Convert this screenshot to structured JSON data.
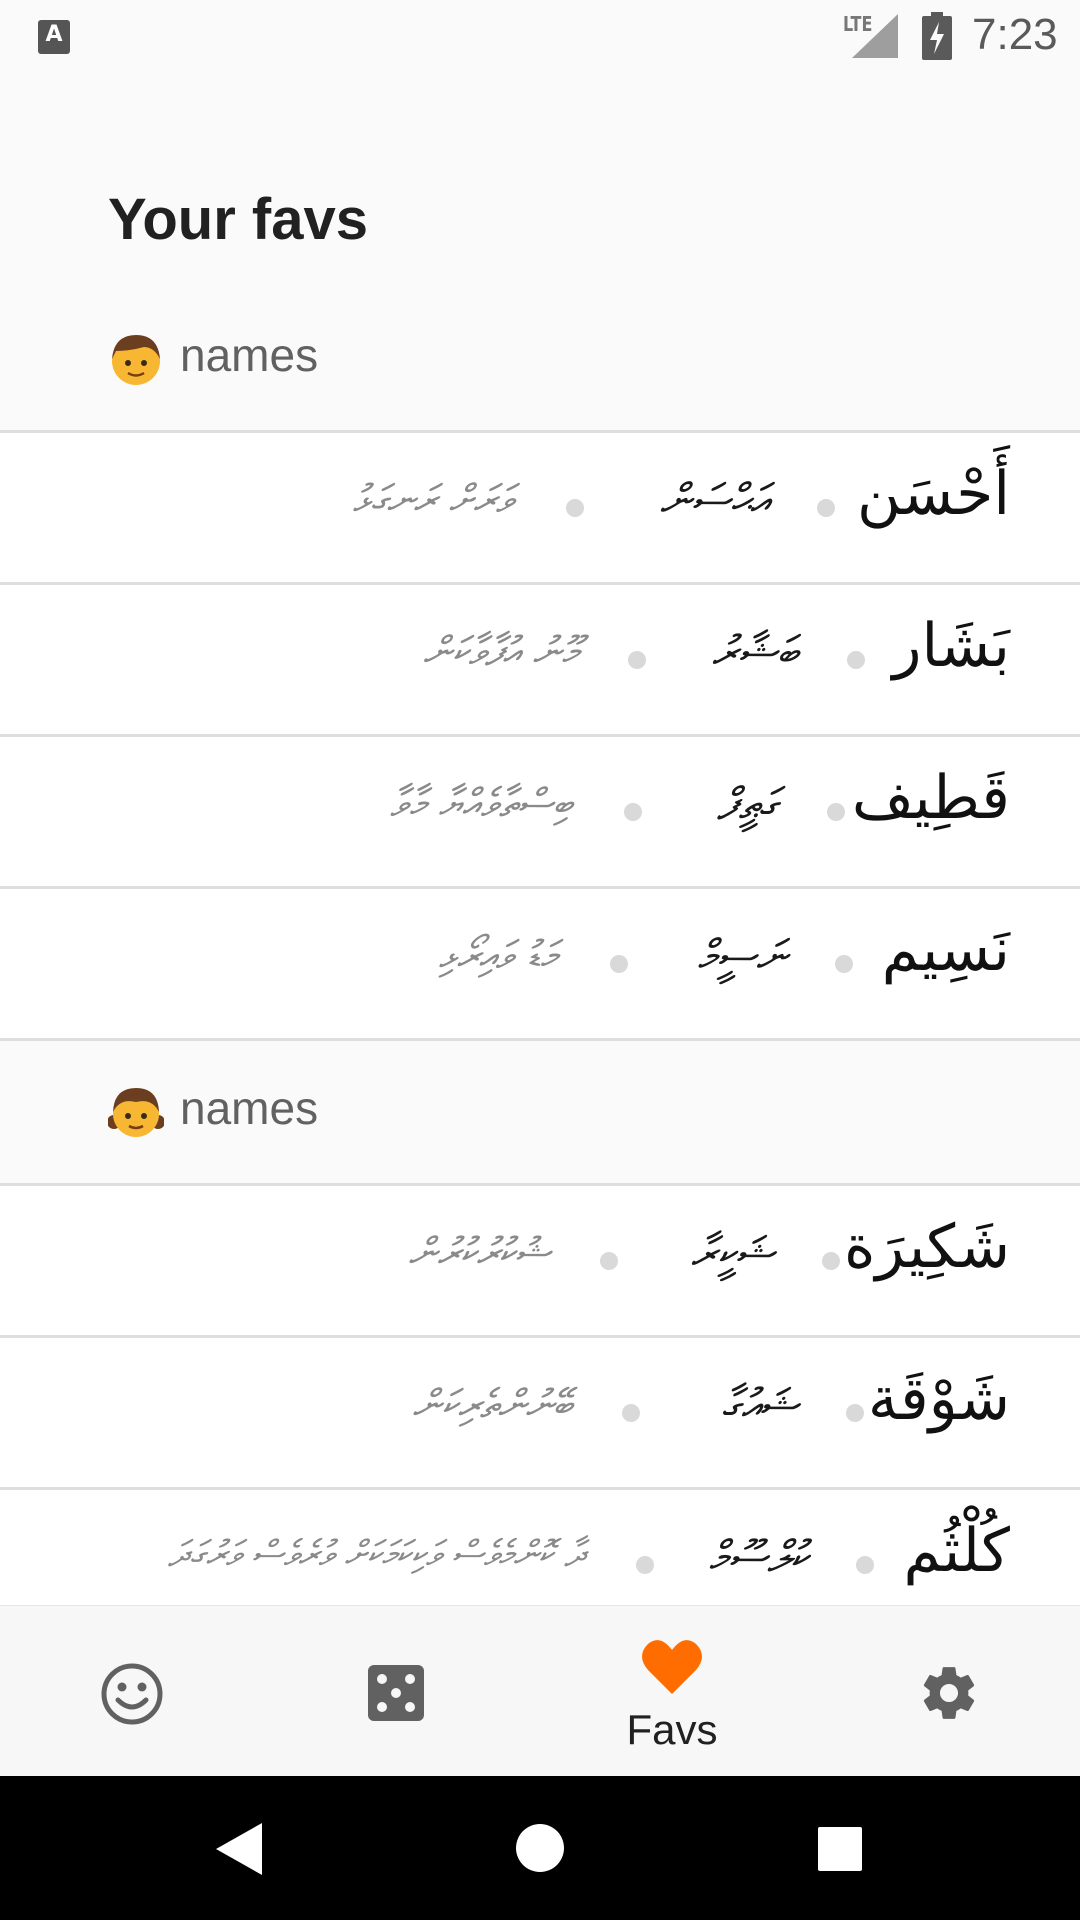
{
  "status_bar": {
    "app_icon_letter": "A",
    "network": "LTE",
    "time": "7:23"
  },
  "page": {
    "title": "Your favs"
  },
  "sections": [
    {
      "emoji": "boy-emoji",
      "label": "names",
      "names": [
        {
          "arabic": "أَحْسَن",
          "thaana": "އަޙްސަން",
          "meaning": "ވަރަށް ރަނގަޅު"
        },
        {
          "arabic": "بَشَار",
          "thaana": "ބަޝާރު",
          "meaning": "މޫނު އުފާވާކަން"
        },
        {
          "arabic": "قَطِيف",
          "thaana": "ގަޠީފް",
          "meaning": "ބިސްތާވެއްޔާ މާވާ"
        },
        {
          "arabic": "نَسِيم",
          "thaana": "ނަސީމް",
          "meaning": "މަޑު ވައިރޯޅި"
        }
      ]
    },
    {
      "emoji": "girl-emoji",
      "label": "names",
      "names": [
        {
          "arabic": "شَكِيرَة",
          "thaana": "ޝަކީރާ",
          "meaning": "ޝުކުރުކުރުން"
        },
        {
          "arabic": "شَوْقَة",
          "thaana": "ޝައުގާ",
          "meaning": "ބޭނުންތެރިކަން"
        },
        {
          "arabic": "كُلْثُم",
          "thaana": "ކުލްސޫމް",
          "meaning": "ދާ ކޮންމެވެސް ވަކިކަމަކަށް ވުރެވެސް ވަރުގަދަ"
        }
      ]
    }
  ],
  "bottom_nav": {
    "items": [
      {
        "icon": "smiley-icon",
        "label": ""
      },
      {
        "icon": "dice-icon",
        "label": ""
      },
      {
        "icon": "heart-icon",
        "label": "Favs",
        "active": true
      },
      {
        "icon": "gear-icon",
        "label": ""
      }
    ],
    "accent_color": "#ff6d00",
    "icon_color": "#616161"
  },
  "system_nav": {
    "buttons": [
      "back-icon",
      "home-icon",
      "recents-icon"
    ]
  }
}
